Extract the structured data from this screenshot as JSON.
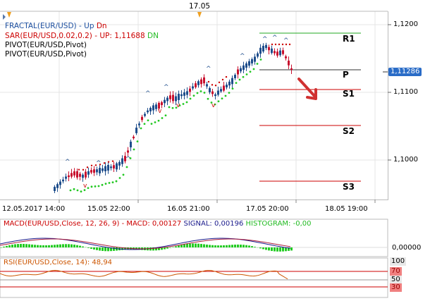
{
  "header": {
    "time_marker": "17.05"
  },
  "legend": {
    "fractal_name": "FRACTAL(EUR/USD)",
    "fractal_sep": "-",
    "fractal_up": "Up",
    "fractal_dn": "Dn",
    "sar_name": "SAR(EUR/USD,0.02,0.2)",
    "sar_sep": "-",
    "sar_up": "UP: 1,11688",
    "sar_dn": "DN",
    "pivot1": "PIVOT(EUR/USD,Pivot)",
    "pivot2": "PIVOT(EUR/USD,Pivot)"
  },
  "pivots": {
    "r1": "R1",
    "p": "P",
    "s1": "S1",
    "s2": "S2",
    "s3": "S3"
  },
  "price_axis": {
    "ticks": [
      "1,1200",
      "1,1100",
      "1,1000"
    ],
    "current_price": "1,11286"
  },
  "time_axis": {
    "ticks": [
      "12.05.2017 14:00",
      "15.05 22:00",
      "16.05 21:00",
      "17.05 20:00",
      "18.05 19:00"
    ]
  },
  "macd": {
    "label_name": "MACD(EUR/USD,Close, 12, 26, 9)",
    "label_sep": "-",
    "label_macd": "MACD: 0,00127",
    "label_signal": "SIGNAL: 0,00196",
    "label_histogram": "HISTOGRAM: -0,00",
    "axis_value": "0,00000"
  },
  "rsi": {
    "label": "RSI(EUR/USD,Close, 14): 48,94",
    "levels": [
      "100",
      "70",
      "50",
      "30"
    ]
  },
  "colors": {
    "bull_candle": "#1f4e8c",
    "bear_candle": "#c8102e",
    "sar_dots": "#22c822",
    "pivot_green": "#22aa22",
    "pivot_red": "#cc0000",
    "fractal_up": "#1f4e8c",
    "fractal_dn": "#cc0000",
    "legend_blue": "#1e50a0",
    "legend_red": "#cc0000",
    "legend_green": "#22bb22",
    "macd_hist": "#22cc22",
    "macd_line": "#1a1a8c",
    "signal_line": "#aa1a3a",
    "rsi_line": "#cc5500"
  }
}
